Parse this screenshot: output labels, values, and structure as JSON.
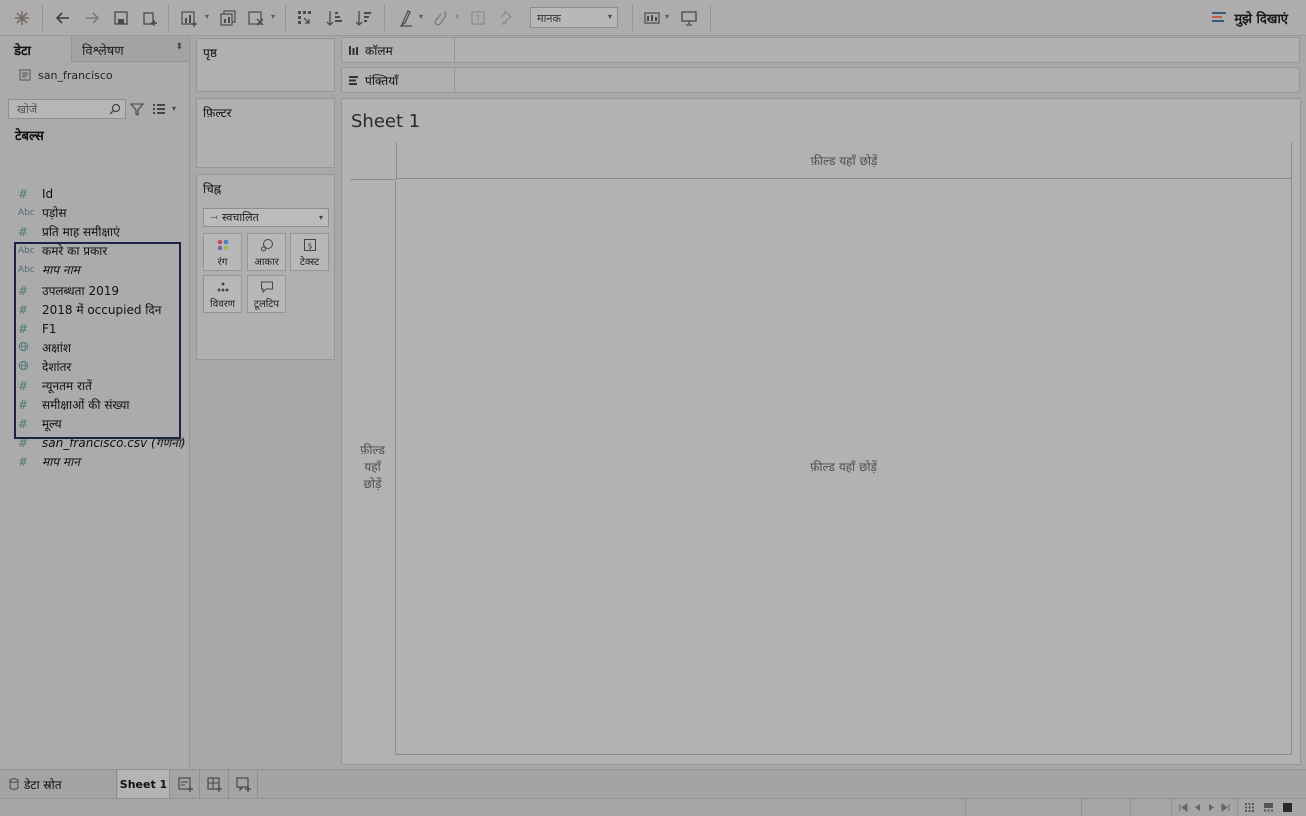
{
  "toolbar": {
    "fit_value": "मानक",
    "show_me_label": "मुझे दिखाएं"
  },
  "data_pane": {
    "tab_data": "डेटा",
    "tab_analysis": "विश्लेषण",
    "datasource_name": "san_francisco",
    "search_placeholder": "खोजें",
    "tables_title": "टेबल्स",
    "fields": [
      {
        "type": "#",
        "name": "Id",
        "italic": false
      },
      {
        "type": "Abc",
        "name": "पड़ोस",
        "italic": false
      },
      {
        "type": "#",
        "name": "प्रति माह समीक्षाएं",
        "italic": false
      },
      {
        "type": "Abc",
        "name": "कमरे का प्रकार",
        "italic": false
      },
      {
        "type": "Abc",
        "name": "माप नाम",
        "italic": true
      },
      {
        "type": "#",
        "name": "उपलब्धता 2019",
        "italic": false
      },
      {
        "type": "#",
        "name": "2018 में occupied दिन",
        "italic": false
      },
      {
        "type": "#",
        "name": "F1",
        "italic": false
      },
      {
        "type": "geo",
        "name": "अक्षांश",
        "italic": false
      },
      {
        "type": "geo",
        "name": "देशांतर",
        "italic": false
      },
      {
        "type": "#",
        "name": "न्यूनतम रातें",
        "italic": false
      },
      {
        "type": "#",
        "name": "समीक्षाओं की संख्या",
        "italic": false
      },
      {
        "type": "#",
        "name": "मूल्य",
        "italic": false
      },
      {
        "type": "#",
        "name": "san_francisco.csv (गणना)",
        "italic": true
      },
      {
        "type": "#",
        "name": "माप मान",
        "italic": true
      }
    ]
  },
  "cards": {
    "pages_title": "पृष्ठ",
    "filters_title": "फ़िल्टर",
    "marks_title": "चिह्न",
    "mark_type": "स्वचालित",
    "mark_buttons": {
      "color": "रंग",
      "size": "आकार",
      "text": "टेक्स्ट",
      "detail": "विवरण",
      "tooltip": "टूलटिप"
    }
  },
  "shelves": {
    "columns_label": "कॉलम",
    "rows_label": "पंक्तियाँ"
  },
  "sheet": {
    "title": "Sheet 1",
    "drop_top": "फ़ील्ड यहाँ छोड़ें",
    "drop_left": "फ़ील्ड यहाँ छोड़ें",
    "drop_main": "फ़ील्ड यहाँ छोड़ें"
  },
  "tabs": {
    "datasource_label": "डेटा स्रोत",
    "sheet1_label": "Sheet 1"
  }
}
